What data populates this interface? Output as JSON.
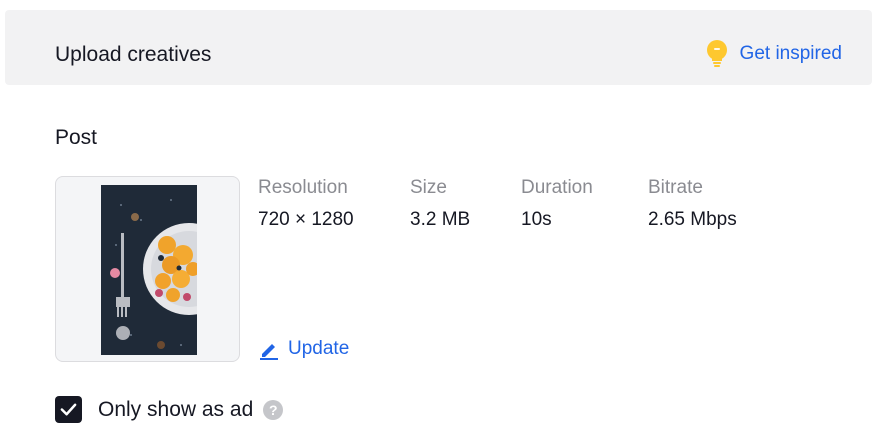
{
  "header": {
    "title": "Upload creatives",
    "inspire_label": "Get inspired",
    "inspire_icon": "lightbulb-icon",
    "accent_color": "#2165e6",
    "bulb_color": "#fec82f"
  },
  "post": {
    "section_label": "Post",
    "thumbnail_icon": "video-thumbnail",
    "meta": [
      {
        "key": "Resolution",
        "value": "720 × 1280"
      },
      {
        "key": "Size",
        "value": "3.2 MB"
      },
      {
        "key": "Duration",
        "value": "10s"
      },
      {
        "key": "Bitrate",
        "value": "2.65 Mbps"
      }
    ],
    "update_label": "Update",
    "update_icon": "pencil-icon"
  },
  "options": {
    "only_show_as_ad_label": "Only show as ad",
    "only_show_as_ad_checked": true,
    "help_icon": "question-icon",
    "help_glyph": "?"
  }
}
